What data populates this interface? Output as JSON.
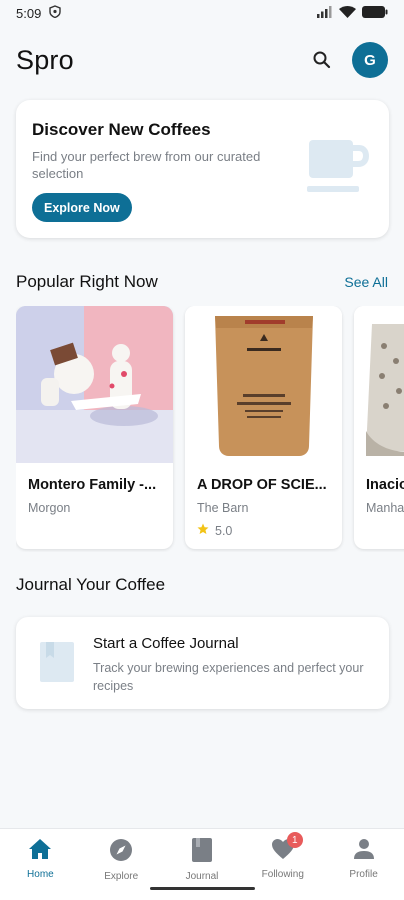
{
  "status": {
    "time": "5:09"
  },
  "header": {
    "title": "Spro",
    "avatar_initial": "G"
  },
  "hero": {
    "title": "Discover New Coffees",
    "subtitle": "Find your perfect brew from our curated selection",
    "button_label": "Explore Now"
  },
  "popular": {
    "title": "Popular Right Now",
    "see_all": "See All",
    "items": [
      {
        "name": "Montero Family -...",
        "roaster": "Morgon",
        "rating": ""
      },
      {
        "name": "A DROP OF SCIE...",
        "roaster": "The Barn",
        "rating": "5.0"
      },
      {
        "name": "Inacio",
        "roaster": "Manha",
        "rating": ""
      }
    ]
  },
  "journal": {
    "section_title": "Journal Your Coffee",
    "card_title": "Start a Coffee Journal",
    "card_sub": "Track your brewing experiences and perfect your recipes"
  },
  "nav": {
    "items": [
      {
        "label": "Home",
        "icon": "home-icon",
        "active": true
      },
      {
        "label": "Explore",
        "icon": "compass-icon"
      },
      {
        "label": "Journal",
        "icon": "book-icon"
      },
      {
        "label": "Following",
        "icon": "heart-icon",
        "badge": "1"
      },
      {
        "label": "Profile",
        "icon": "person-icon"
      }
    ]
  },
  "colors": {
    "primary": "#0e6f96",
    "background": "#f6f8fa",
    "badge": "#e85b5b",
    "star": "#f2c316"
  }
}
